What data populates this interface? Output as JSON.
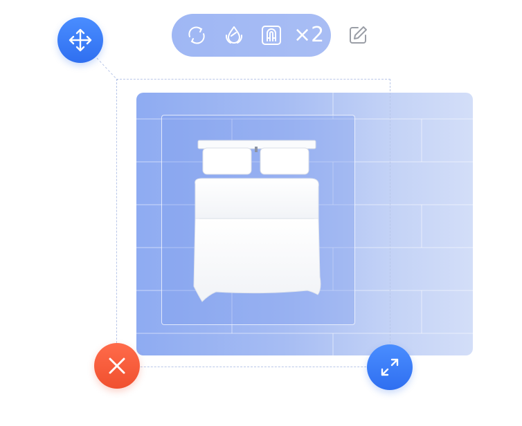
{
  "toolbar": {
    "icons": [
      "rotate-icon",
      "material-icon",
      "magnet-icon"
    ],
    "count_label": "×2"
  },
  "handles": {
    "move": "move-arrows-icon",
    "delete": "close-icon",
    "resize": "resize-diagonal-icon"
  },
  "edit": "edit-pencil-icon",
  "object": "double-bed",
  "colors": {
    "accent_blue": "#3a7bf6",
    "delete_red": "#f45a38",
    "toolbar_bg": "#a3baf4",
    "floor": "#9db5f3"
  }
}
